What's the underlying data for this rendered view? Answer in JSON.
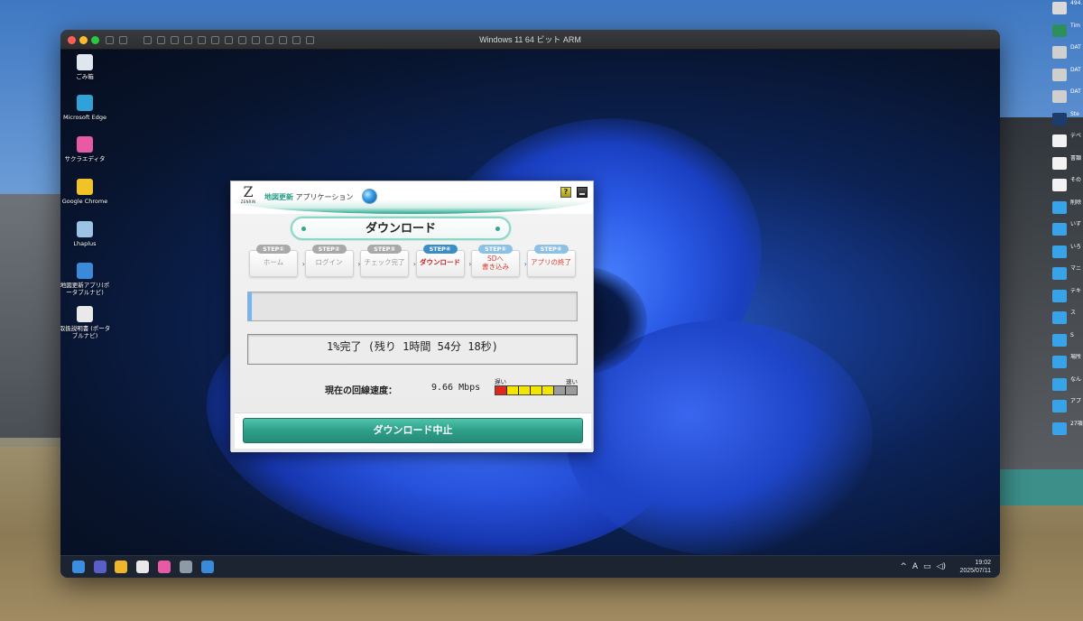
{
  "vm": {
    "title": "Windows 11 64 ビット ARM"
  },
  "desktop_icons": [
    {
      "label": "ごみ箱",
      "icon": "recycle-bin-icon",
      "color": "#dfe6ee"
    },
    {
      "label": "Microsoft Edge",
      "icon": "edge-icon",
      "color": "#2fa3d8"
    },
    {
      "label": "サクラエディタ",
      "icon": "sakura-editor-icon",
      "color": "#e85ba4"
    },
    {
      "label": "Google Chrome",
      "icon": "chrome-icon",
      "color": "#f2c229"
    },
    {
      "label": "Lhaplus",
      "icon": "lhaplus-icon",
      "color": "#9cc3e6"
    },
    {
      "label": "地図更新アプリ(ポータブルナビ)",
      "icon": "map-update-app-icon",
      "color": "#3b8ad9"
    },
    {
      "label": "取扱説明書 (ポータブルナビ)",
      "icon": "pdf-manual-icon",
      "color": "#e9e9e9"
    }
  ],
  "taskbar": {
    "apps": [
      "windows-start-icon",
      "teams-icon",
      "file-explorer-icon",
      "chrome-icon",
      "sakura-editor-icon",
      "settings-icon",
      "map-update-app-icon"
    ],
    "tray_chevron": "^",
    "ime": "A",
    "time": "19:02",
    "date": "2025/07/11"
  },
  "app": {
    "brand": "ZENRIN",
    "title_accent": "地図更新",
    "title_rest": " アプリケーション",
    "help_label": "?",
    "page_title": "ダウンロード",
    "steps": [
      {
        "badge": "STEP①",
        "label": "ホーム",
        "state": "done"
      },
      {
        "badge": "STEP②",
        "label": "ログイン",
        "state": "done"
      },
      {
        "badge": "STEP③",
        "label": "チェック完了",
        "state": "done"
      },
      {
        "badge": "STEP④",
        "label": "ダウンロード",
        "state": "active"
      },
      {
        "badge": "STEP⑤",
        "label": "SDへ\n書き込み",
        "state": "todo"
      },
      {
        "badge": "STEP⑥",
        "label": "アプリの終了",
        "state": "todo"
      }
    ],
    "progress_percent": 1,
    "status_text": "1%完了 (残り 1時間 54分 18秒)",
    "speed_label": "現在の回線速度：",
    "speed_value": "9.66 Mbps",
    "meter": {
      "low_label": "遅い",
      "high_label": "速い",
      "bars": [
        "#e0271d",
        "#f2e600",
        "#f2e600",
        "#f2e600",
        "#f2e600",
        "#9b9b9b",
        "#9b9b9b"
      ]
    },
    "stop_button": "ダウンロード中止"
  },
  "mac_sidebar": [
    {
      "label": "494.",
      "color": "#d9d9d9"
    },
    {
      "label": "Tim",
      "color": "#2d8f5e"
    },
    {
      "label": "DAT",
      "color": "#cfcfcf"
    },
    {
      "label": "DAT",
      "color": "#cfcfcf"
    },
    {
      "label": "DAT",
      "color": "#cfcfcf"
    },
    {
      "label": "Ste",
      "color": "#1b3c6c"
    },
    {
      "label": "デベ",
      "color": "#f2f2f2"
    },
    {
      "label": "書類",
      "color": "#f2f2f2"
    },
    {
      "label": "その",
      "color": "#f2f2f2"
    },
    {
      "label": "削除",
      "color": "#38a3e8"
    },
    {
      "label": "いず",
      "color": "#38a3e8"
    },
    {
      "label": "いろ",
      "color": "#38a3e8"
    },
    {
      "label": "マニ",
      "color": "#38a3e8"
    },
    {
      "label": "テキ",
      "color": "#38a3e8"
    },
    {
      "label": "ス",
      "color": "#38a3e8"
    },
    {
      "label": "S",
      "color": "#38a3e8"
    },
    {
      "label": "場所",
      "color": "#38a3e8"
    },
    {
      "label": "なん",
      "color": "#38a3e8"
    },
    {
      "label": "アプ",
      "color": "#38a3e8"
    },
    {
      "label": "27項",
      "color": "#38a3e8"
    }
  ]
}
